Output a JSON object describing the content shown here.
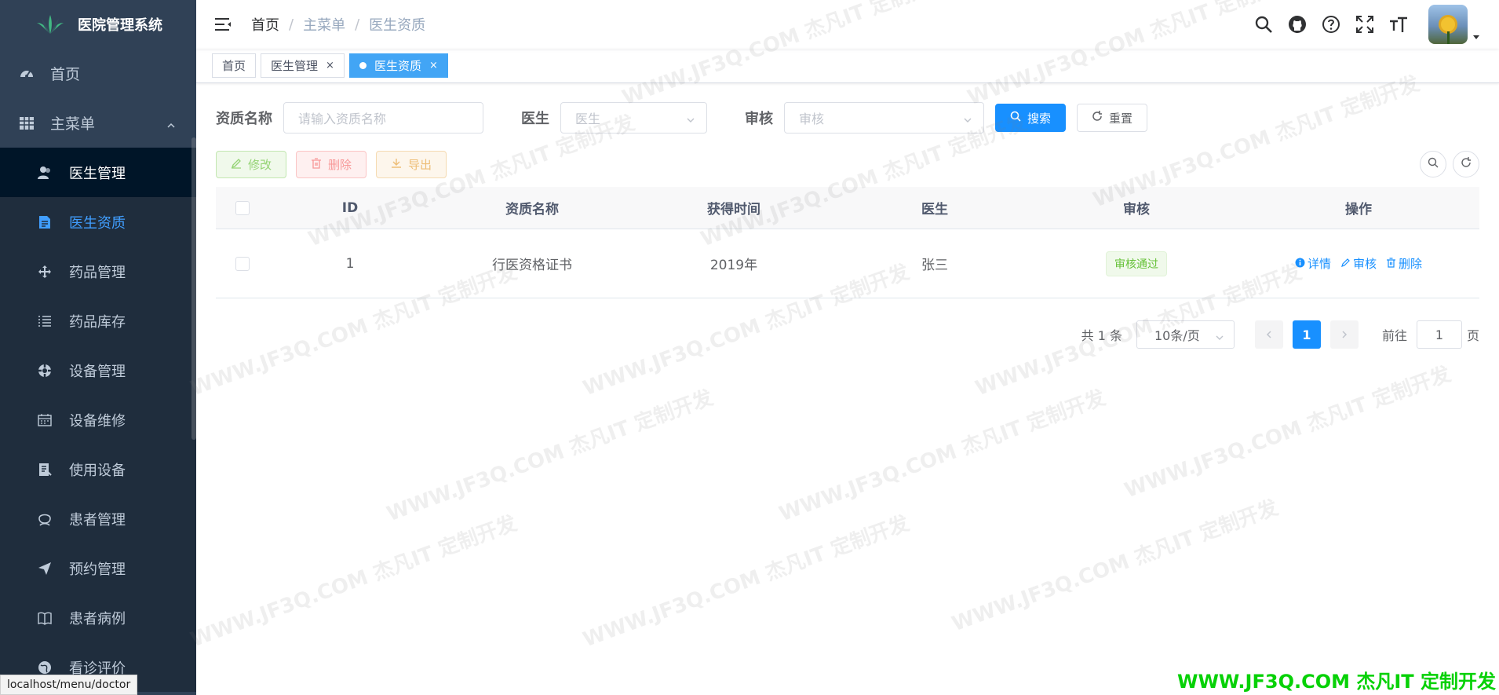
{
  "app": {
    "title": "医院管理系统"
  },
  "sidebar": {
    "top_items": [
      {
        "label": "首页",
        "icon": "dashboard-icon"
      },
      {
        "label": "主菜单",
        "icon": "table-icon"
      }
    ],
    "sub_items": [
      {
        "label": "医生管理",
        "icon": "peoples-icon"
      },
      {
        "label": "医生资质",
        "icon": "document-icon"
      },
      {
        "label": "药品管理",
        "icon": "drag-icon"
      },
      {
        "label": "药品库存",
        "icon": "list-icon"
      },
      {
        "label": "设备管理",
        "icon": "component-icon"
      },
      {
        "label": "设备维修",
        "icon": "date-range-icon"
      },
      {
        "label": "使用设备",
        "icon": "form-icon"
      },
      {
        "label": "患者管理",
        "icon": "people-icon"
      },
      {
        "label": "预约管理",
        "icon": "guide-icon"
      },
      {
        "label": "患者病例",
        "icon": "book-icon"
      },
      {
        "label": "看诊评价",
        "icon": "globe-icon"
      }
    ]
  },
  "status_url": "localhost/menu/doctor",
  "breadcrumb": {
    "home": "首页",
    "parent": "主菜单",
    "current": "医生资质",
    "separator": "/"
  },
  "tags": [
    {
      "label": "首页"
    },
    {
      "label": "医生管理",
      "close": "×"
    },
    {
      "label": "医生资质",
      "close": "×"
    }
  ],
  "search": {
    "name_label": "资质名称",
    "name_placeholder": "请输入资质名称",
    "doctor_label": "医生",
    "doctor_placeholder": "医生",
    "audit_label": "审核",
    "audit_placeholder": "审核",
    "search_button": "搜索",
    "reset_button": "重置"
  },
  "toolbar": {
    "edit": "修改",
    "delete": "删除",
    "export": "导出"
  },
  "table": {
    "headers": [
      "ID",
      "资质名称",
      "获得时间",
      "医生",
      "审核",
      "操作"
    ],
    "rows": [
      {
        "id": "1",
        "name": "行医资格证书",
        "time": "2019年",
        "doctor": "张三",
        "audit": "审核通过"
      }
    ],
    "ops": {
      "detail": "详情",
      "audit": "审核",
      "delete": "删除"
    }
  },
  "pagination": {
    "total": "共 1 条",
    "page_size": "10条/页",
    "current_page": "1",
    "goto_label": "前往",
    "goto_value": "1",
    "page_unit": "页"
  },
  "watermark": {
    "text": "WWW.JF3Q.COM 杰凡IT 定制开发",
    "footer": "WWW.JF3Q.COM 杰凡IT  定制开发"
  },
  "colors": {
    "sidebar_bg": "#304156",
    "primary": "#1890ff",
    "success": "#67c23a",
    "watermark_footer": "#07d107"
  }
}
